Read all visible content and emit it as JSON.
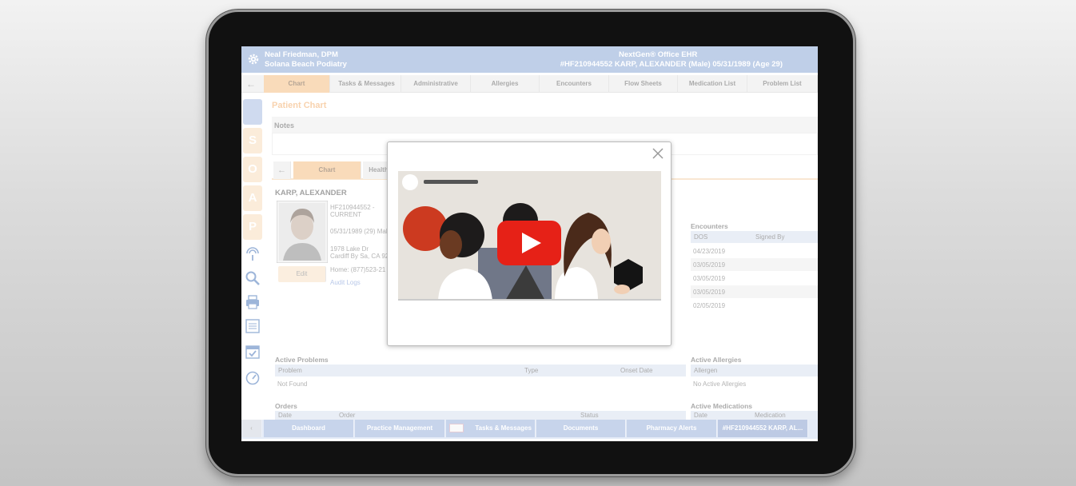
{
  "header": {
    "provider": "Neal Friedman, DPM",
    "practice": "Solana Beach Podiatry",
    "app_name": "NextGen® Office EHR",
    "patient_line": "#HF210944552   KARP, ALEXANDER   (Male)   05/31/1989   (Age 29)"
  },
  "main_tabs": [
    "Chart",
    "Tasks & Messages",
    "Administrative",
    "Allergies",
    "Encounters",
    "Flow Sheets",
    "Medication List",
    "Problem List"
  ],
  "side_letters": [
    "S",
    "O",
    "A",
    "P"
  ],
  "page_title": "Patient Chart",
  "notes_label": "Notes",
  "sub_tabs": [
    "Chart",
    "Health"
  ],
  "patient": {
    "name": "KARP, ALEXANDER",
    "id": "HF210944552 -",
    "status": "CURRENT",
    "dob_line": "05/31/1989 (29) Mal",
    "address1": "1978 Lake Dr",
    "address2": "Cardiff By Sa, CA 92",
    "phone": "Home: (877)523-21",
    "edit_label": "Edit",
    "audit_link": "Audit Logs"
  },
  "encounters": {
    "title": "Encounters",
    "columns": [
      "DOS",
      "Signed By"
    ],
    "rows": [
      "04/23/2019",
      "03/05/2019",
      "03/05/2019",
      "03/05/2019",
      "02/05/2019"
    ]
  },
  "active_problems": {
    "title": "Active Problems",
    "columns": [
      "Problem",
      "Type",
      "Onset Date"
    ],
    "empty": "Not Found"
  },
  "active_allergies": {
    "title": "Active Allergies",
    "columns": [
      "Allergen"
    ],
    "empty": "No Active Allergies"
  },
  "orders": {
    "title": "Orders",
    "columns": [
      "Date",
      "Order",
      "Status"
    ]
  },
  "active_medications": {
    "title": "Active Medications",
    "columns": [
      "Date",
      "Medication"
    ]
  },
  "taskbar": [
    "Dashboard",
    "Practice Management",
    "Tasks & Messages",
    "Documents",
    "Pharmacy Alerts",
    "#HF210944552  KARP, AL..."
  ],
  "colors": {
    "header_blue": "#7f9fd0",
    "tab_orange": "#f3b675",
    "play_red": "#e62117"
  },
  "icons": [
    "gear-icon",
    "back-arrow-icon",
    "stethoscope-icon",
    "search-icon",
    "printer-icon",
    "notes-icon",
    "calendar-check-icon",
    "gauge-icon",
    "close-icon",
    "play-icon",
    "mail-icon"
  ]
}
